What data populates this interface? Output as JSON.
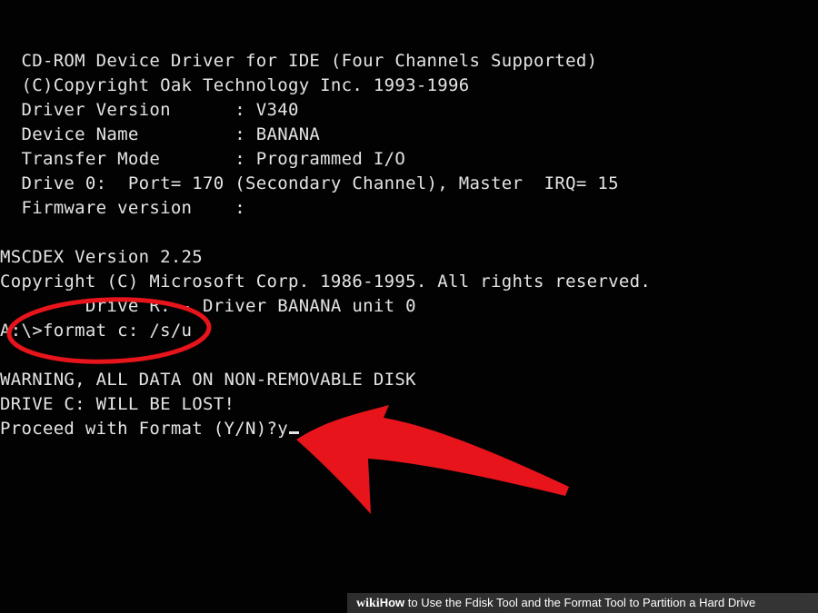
{
  "console": {
    "lines": [
      "  CD-ROM Device Driver for IDE (Four Channels Supported)",
      "  (C)Copyright Oak Technology Inc. 1993-1996",
      "  Driver Version      : V340",
      "  Device Name         : BANANA",
      "  Transfer Mode       : Programmed I/O",
      "  Drive 0:  Port= 170 (Secondary Channel), Master  IRQ= 15",
      "  Firmware version    :",
      "",
      "MSCDEX Version 2.25",
      "Copyright (C) Microsoft Corp. 1986-1995. All rights reserved.",
      "        Drive R: - Driver BANANA unit 0",
      "A:\\>format c: /s/u",
      "",
      "WARNING, ALL DATA ON NON-REMOVABLE DISK",
      "DRIVE C: WILL BE LOST!",
      "Proceed with Format (Y/N)?y"
    ]
  },
  "annotation_color": "#e8141b",
  "banner": {
    "wiki_mark": "wiki",
    "howto": "How",
    "title": " to Use the Fdisk Tool and the Format Tool to Partition a Hard Drive"
  }
}
